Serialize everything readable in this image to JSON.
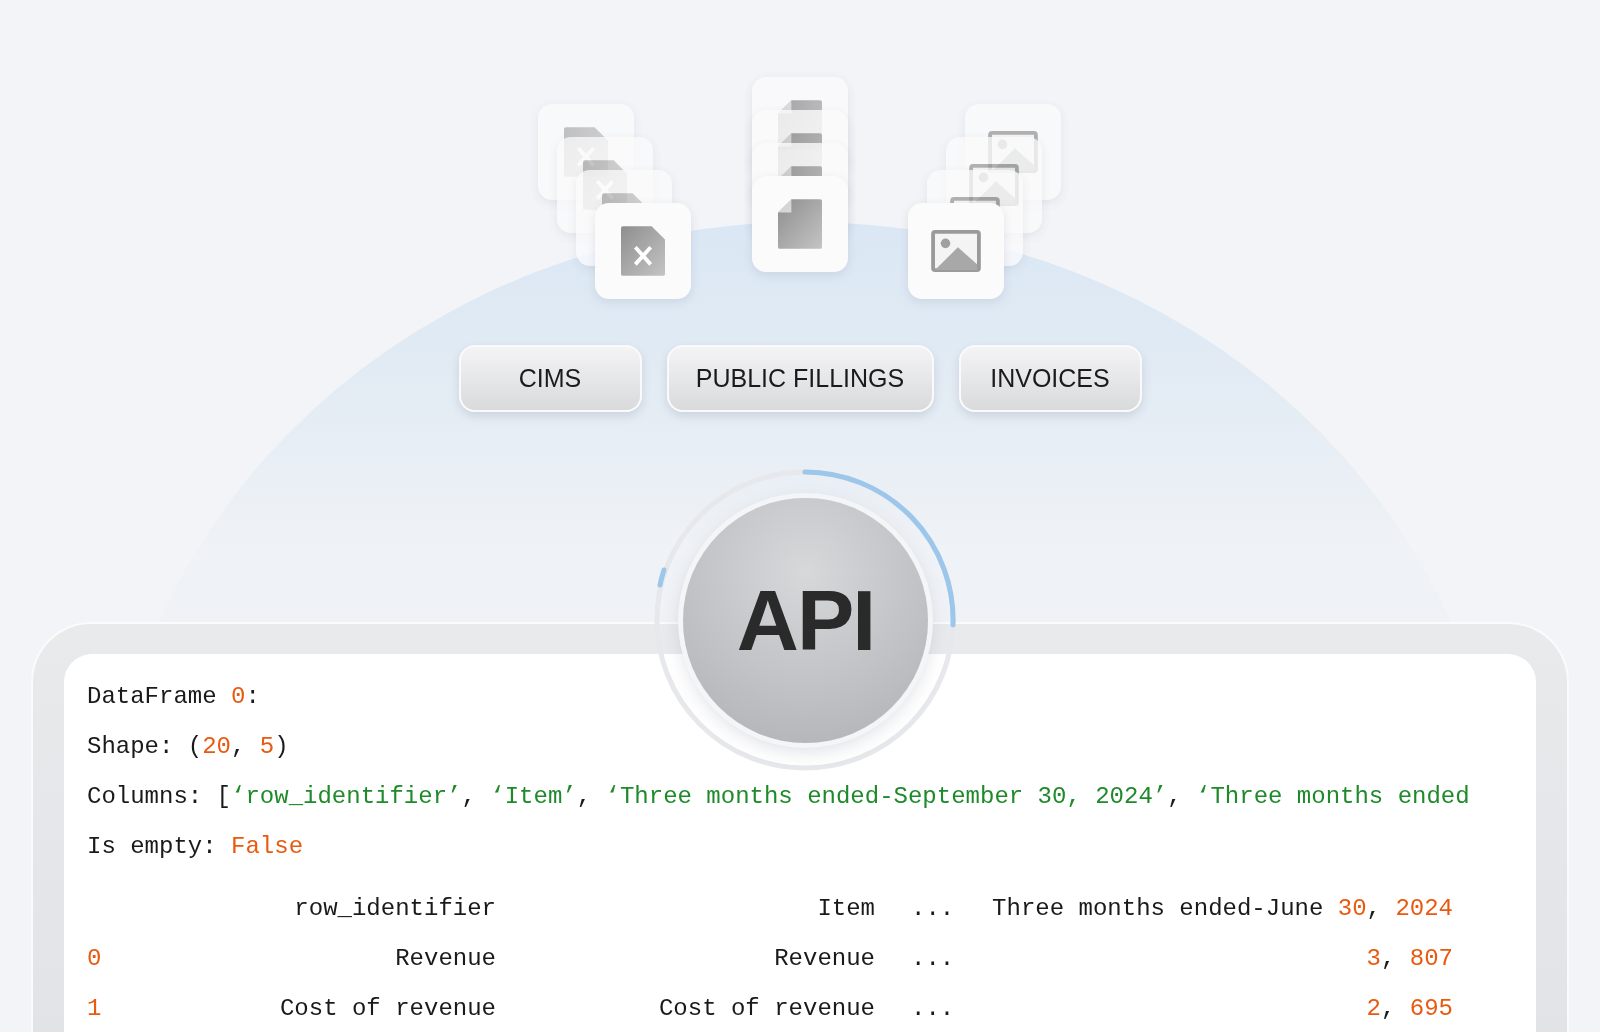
{
  "sources": [
    {
      "label": "CIMS"
    },
    {
      "label": "PUBLIC FILLINGS"
    },
    {
      "label": "INVOICES"
    }
  ],
  "api": {
    "label": "API"
  },
  "output": {
    "lines": [
      [
        {
          "text": "DataFrame ",
          "kind": "plain"
        },
        {
          "text": "0",
          "kind": "number"
        },
        {
          "text": ":",
          "kind": "plain"
        }
      ],
      [
        {
          "text": "Shape: (",
          "kind": "plain"
        },
        {
          "text": "20",
          "kind": "number"
        },
        {
          "text": ", ",
          "kind": "plain"
        },
        {
          "text": "5",
          "kind": "number"
        },
        {
          "text": ")",
          "kind": "plain"
        }
      ],
      [
        {
          "text": "Columns: [",
          "kind": "plain"
        },
        {
          "text": "‘row_identifier’",
          "kind": "string"
        },
        {
          "text": ", ",
          "kind": "plain"
        },
        {
          "text": "‘Item’",
          "kind": "string"
        },
        {
          "text": ", ",
          "kind": "plain"
        },
        {
          "text": "‘Three months ended-September 30, 2024’",
          "kind": "string"
        },
        {
          "text": ", ",
          "kind": "plain"
        },
        {
          "text": "‘Three months ended",
          "kind": "string"
        }
      ],
      [
        {
          "text": "Is empty: ",
          "kind": "plain"
        },
        {
          "text": "False",
          "kind": "number"
        }
      ]
    ],
    "table": {
      "header": [
        [
          {
            "text": "row_identifier",
            "kind": "plain"
          }
        ],
        [
          {
            "text": "Item",
            "kind": "plain"
          }
        ],
        [
          {
            "text": "...",
            "kind": "plain"
          }
        ],
        [
          {
            "text": "Three months ended-June ",
            "kind": "plain"
          },
          {
            "text": "30",
            "kind": "number"
          },
          {
            "text": ", ",
            "kind": "plain"
          },
          {
            "text": "2024",
            "kind": "number"
          }
        ]
      ],
      "rows": [
        [
          [
            {
              "text": "0",
              "kind": "number"
            }
          ],
          [
            {
              "text": "Revenue",
              "kind": "plain"
            }
          ],
          [
            {
              "text": "Revenue",
              "kind": "plain"
            }
          ],
          [
            {
              "text": "...",
              "kind": "plain"
            }
          ],
          [
            {
              "text": "3",
              "kind": "number"
            },
            {
              "text": ", ",
              "kind": "plain"
            },
            {
              "text": "807",
              "kind": "number"
            }
          ]
        ],
        [
          [
            {
              "text": "1",
              "kind": "number"
            }
          ],
          [
            {
              "text": "Cost of revenue",
              "kind": "plain"
            }
          ],
          [
            {
              "text": "Cost of revenue",
              "kind": "plain"
            }
          ],
          [
            {
              "text": "...",
              "kind": "plain"
            }
          ],
          [
            {
              "text": "2",
              "kind": "number"
            },
            {
              "text": ", ",
              "kind": "plain"
            },
            {
              "text": "695",
              "kind": "number"
            }
          ]
        ]
      ]
    }
  }
}
